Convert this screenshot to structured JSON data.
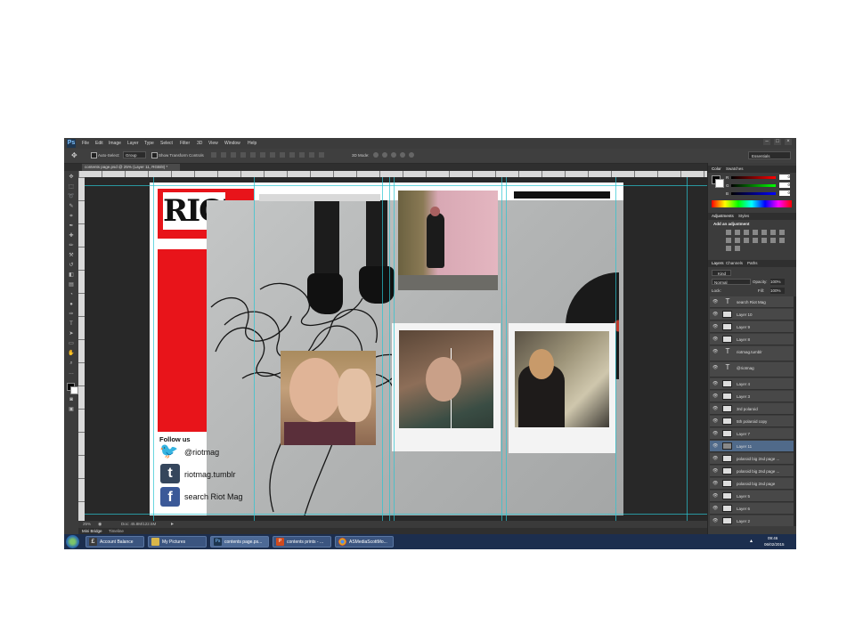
{
  "app": {
    "logo": "Ps",
    "menu": [
      "File",
      "Edit",
      "Image",
      "Layer",
      "Type",
      "Select",
      "Filter",
      "3D",
      "View",
      "Window",
      "Help"
    ],
    "window_buttons": [
      "–",
      "□",
      "×"
    ]
  },
  "options_bar": {
    "auto_select_label": "Auto-Select:",
    "auto_select_value": "Group",
    "show_transform_label": "Show Transform Controls",
    "mode_3d_label": "3D Mode:",
    "workspace": "Essentials"
  },
  "document": {
    "tab_title": "contents page.psd @ 25% (Layer 11, RGB/8) *",
    "zoom": "25%",
    "doc_size": "Doc: 45.8M/122.5M"
  },
  "bottom_tabs": [
    "Mini Bridge",
    "Timeline"
  ],
  "canvas": {
    "logo_text": "RIOT",
    "follow_us": "Follow us",
    "twitter": "@riotmag",
    "tumblr": "riotmag.tumblr",
    "facebook": "search Riot Mag"
  },
  "panels": {
    "color_tabs": [
      "Color",
      "Swatches"
    ],
    "color_channels": [
      {
        "label": "R",
        "value": "0"
      },
      {
        "label": "G",
        "value": "0"
      },
      {
        "label": "B",
        "value": "0"
      }
    ],
    "adjust_tabs": [
      "Adjustments",
      "Styles"
    ],
    "adjust_title": "Add an adjustment",
    "layers_tabs": [
      "Layers",
      "Channels",
      "Paths"
    ],
    "kind_label": "Kind",
    "blend_mode": "Normal",
    "opacity_label": "Opacity:",
    "opacity_value": "100%",
    "lock_label": "Lock:",
    "fill_label": "Fill:",
    "fill_value": "100%",
    "layers": [
      {
        "name": "search Riot Mag",
        "type": "text"
      },
      {
        "name": "Layer 10",
        "type": "pixel"
      },
      {
        "name": "Layer 9",
        "type": "pixel"
      },
      {
        "name": "Layer 8",
        "type": "pixel"
      },
      {
        "name": "riotmag.tumblr",
        "type": "text"
      },
      {
        "name": "@riotmag",
        "type": "text"
      },
      {
        "name": "Layer 4",
        "type": "pixel"
      },
      {
        "name": "Layer 3",
        "type": "pixel"
      },
      {
        "name": "3rd polaroid",
        "type": "pixel"
      },
      {
        "name": "5th polaroid copy",
        "type": "pixel"
      },
      {
        "name": "Layer 7",
        "type": "pixel"
      },
      {
        "name": "Layer 11",
        "type": "pixel",
        "selected": true
      },
      {
        "name": "polaroid big 2nd page ...",
        "type": "pixel"
      },
      {
        "name": "polaroid big 2nd page ...",
        "type": "pixel"
      },
      {
        "name": "polaroid big 2nd page",
        "type": "pixel"
      },
      {
        "name": "Layer 5",
        "type": "pixel"
      },
      {
        "name": "Layer 6",
        "type": "pixel"
      },
      {
        "name": "Layer 2",
        "type": "pixel"
      }
    ]
  },
  "taskbar": {
    "items": [
      {
        "label": "Account Balance",
        "color": "#3b3b3b"
      },
      {
        "label": "My Pictures",
        "color": "#d8b64a"
      },
      {
        "label": "contents page.ps...",
        "color": "#1e3650"
      },
      {
        "label": "contents prints - ...",
        "color": "#d04a1e"
      },
      {
        "label": "ASMediaScottMo...",
        "color": "#e0a020"
      }
    ],
    "time": "09:46",
    "date": "06/02/2015"
  }
}
